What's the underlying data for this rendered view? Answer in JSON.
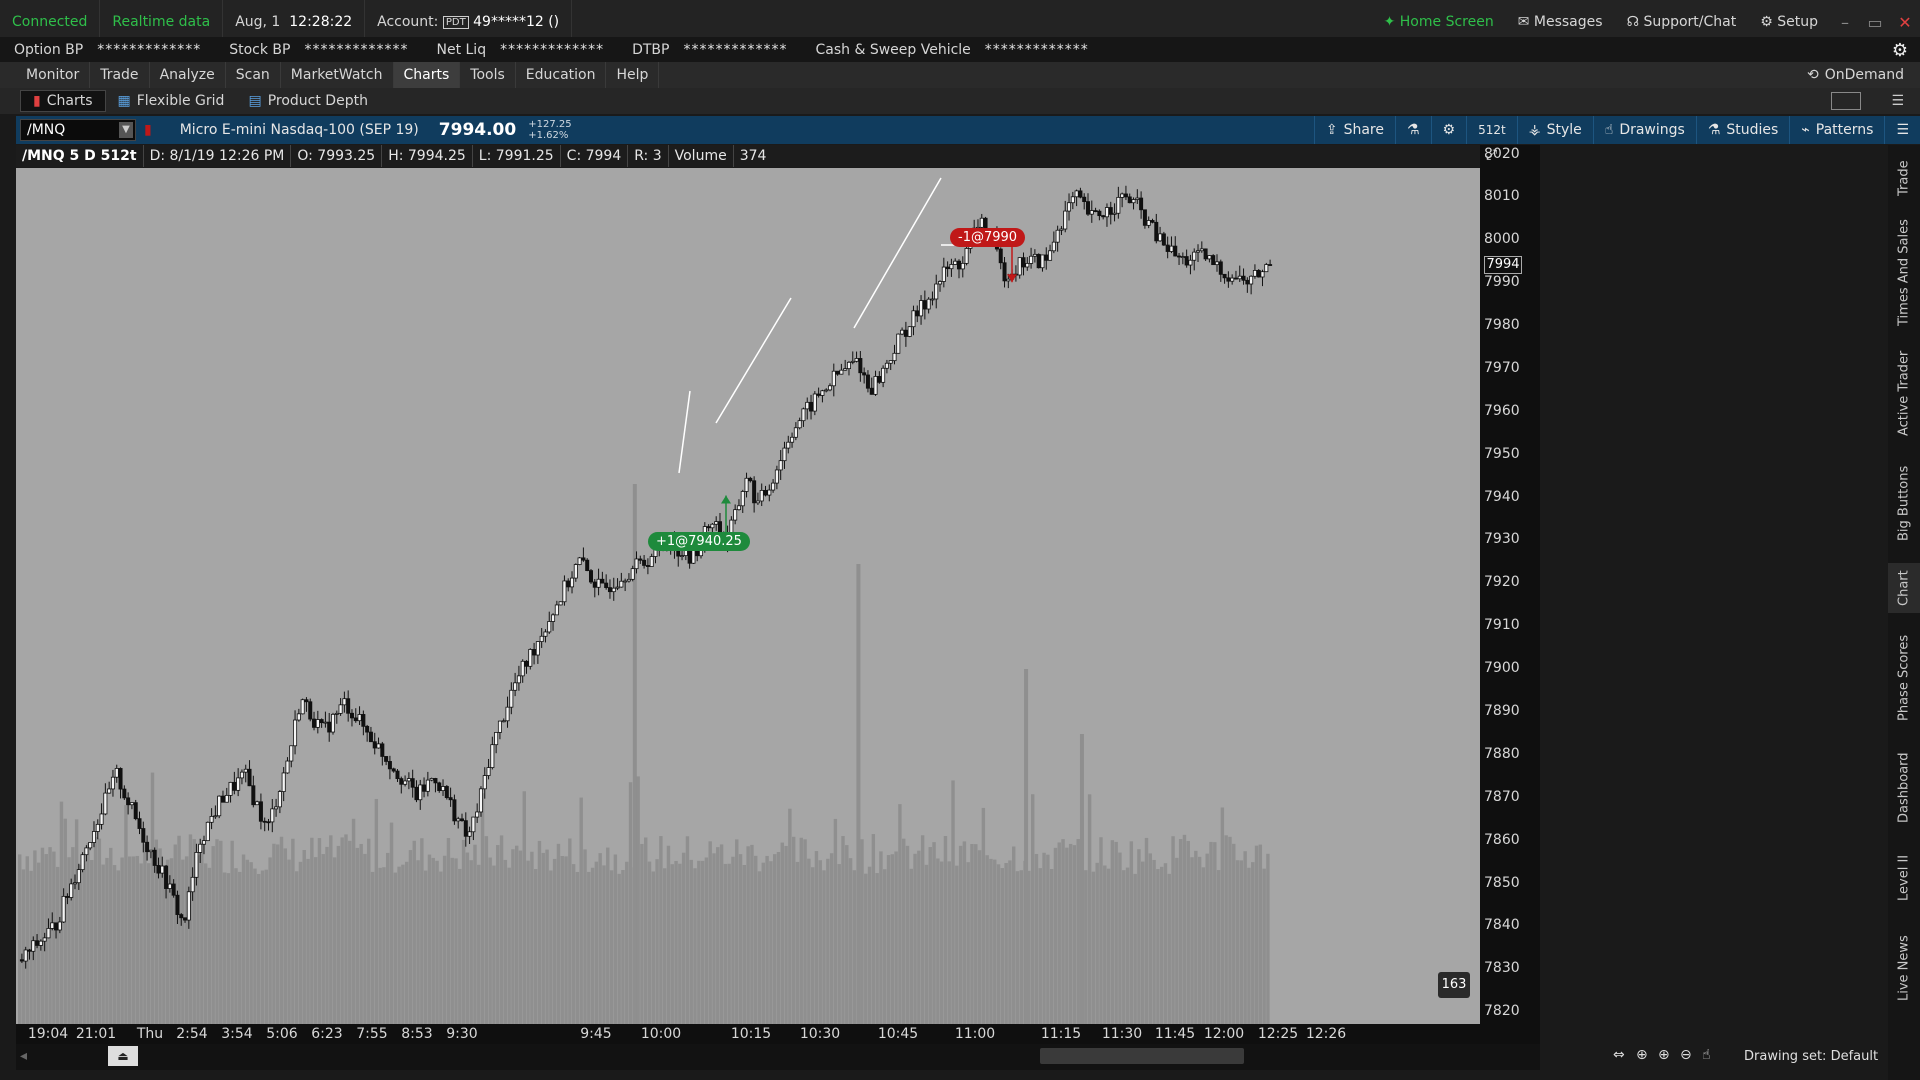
{
  "topbar": {
    "connected": "Connected",
    "realtime": "Realtime data",
    "date": "Aug, 1",
    "time": "12:28:22",
    "account_label": "Account:",
    "account_badge": "PDT",
    "account_value": "49*****12 ()",
    "home": "Home Screen",
    "messages": "Messages",
    "support": "Support/Chat",
    "setup": "Setup"
  },
  "bp": [
    {
      "label": "Option BP",
      "value": "*************"
    },
    {
      "label": "Stock BP",
      "value": "*************"
    },
    {
      "label": "Net Liq",
      "value": "*************"
    },
    {
      "label": "DTBP",
      "value": "*************"
    },
    {
      "label": "Cash & Sweep Vehicle",
      "value": "*************"
    }
  ],
  "menu": {
    "items": [
      "Monitor",
      "Trade",
      "Analyze",
      "Scan",
      "MarketWatch",
      "Charts",
      "Tools",
      "Education",
      "Help"
    ],
    "active": "Charts",
    "ondemand": "OnDemand"
  },
  "subtabs": [
    "Charts",
    "Flexible Grid",
    "Product Depth"
  ],
  "chart_header": {
    "symbol": "/MNQ",
    "description": "Micro E-mini Nasdaq-100 (SEP 19)",
    "price": "7994.00",
    "change": "+127.25",
    "change_pct": "+1.62%",
    "share": "Share",
    "aggregation": "512t",
    "style": "Style",
    "drawings": "Drawings",
    "studies": "Studies",
    "patterns": "Patterns"
  },
  "infobar": {
    "symbol": "/MNQ 5 D 512t",
    "date": "D: 8/1/19 12:26 PM",
    "open": "O: 7993.25",
    "high": "H: 7994.25",
    "low": "L: 7991.25",
    "close": "C: 7994",
    "range": "R: 3",
    "volume_label": "Volume",
    "volume_value": "374"
  },
  "chart_data": {
    "type": "candlestick",
    "y_ticks": [
      8020,
      8010,
      8000,
      7990,
      7980,
      7970,
      7960,
      7950,
      7940,
      7930,
      7920,
      7910,
      7900,
      7890,
      7880,
      7870,
      7860,
      7850,
      7840,
      7830,
      7820
    ],
    "ylim": [
      7817,
      8022
    ],
    "x_ticks": [
      "19:04",
      "21:01",
      "Thu",
      "2:54",
      "3:54",
      "5:06",
      "6:23",
      "7:55",
      "8:53",
      "9:30",
      "9:45",
      "10:00",
      "10:15",
      "10:30",
      "10:45",
      "11:00",
      "11:15",
      "11:30",
      "11:45",
      "12:00",
      "12:25",
      "12:26"
    ],
    "current_price_label": "7994",
    "price_anchors": [
      [
        0,
        7832
      ],
      [
        0.03,
        7840
      ],
      [
        0.06,
        7860
      ],
      [
        0.085,
        7875
      ],
      [
        0.11,
        7860
      ],
      [
        0.13,
        7850
      ],
      [
        0.145,
        7840
      ],
      [
        0.16,
        7860
      ],
      [
        0.18,
        7870
      ],
      [
        0.2,
        7875
      ],
      [
        0.22,
        7862
      ],
      [
        0.24,
        7880
      ],
      [
        0.25,
        7893
      ],
      [
        0.27,
        7885
      ],
      [
        0.29,
        7892
      ],
      [
        0.31,
        7885
      ],
      [
        0.33,
        7878
      ],
      [
        0.355,
        7870
      ],
      [
        0.37,
        7875
      ],
      [
        0.385,
        7868
      ],
      [
        0.4,
        7860
      ],
      [
        0.41,
        7868
      ],
      [
        0.42,
        7880
      ],
      [
        0.44,
        7895
      ],
      [
        0.46,
        7905
      ],
      [
        0.48,
        7915
      ],
      [
        0.5,
        7925
      ],
      [
        0.52,
        7918
      ],
      [
        0.54,
        7922
      ],
      [
        0.56,
        7925
      ],
      [
        0.58,
        7930
      ],
      [
        0.6,
        7925
      ],
      [
        0.61,
        7930
      ],
      [
        0.62,
        7935
      ],
      [
        0.63,
        7930
      ],
      [
        0.64,
        7935
      ],
      [
        0.65,
        7945
      ],
      [
        0.66,
        7938
      ],
      [
        0.67,
        7942
      ],
      [
        0.69,
        7955
      ],
      [
        0.71,
        7962
      ],
      [
        0.73,
        7968
      ],
      [
        0.75,
        7972
      ],
      [
        0.76,
        7965
      ],
      [
        0.77,
        7968
      ],
      [
        0.79,
        7978
      ],
      [
        0.81,
        7985
      ],
      [
        0.83,
        7993
      ],
      [
        0.845,
        7995
      ],
      [
        0.86,
        8005
      ],
      [
        0.87,
        8000
      ],
      [
        0.88,
        7992
      ],
      [
        0.89,
        7993
      ],
      [
        0.9,
        7995
      ],
      [
        0.92,
        7995
      ],
      [
        0.93,
        8003
      ],
      [
        0.945,
        8010
      ],
      [
        0.96,
        8005
      ],
      [
        0.975,
        8007
      ],
      [
        0.99,
        8010
      ],
      [
        1.0,
        8008
      ],
      [
        1.02,
        8000
      ],
      [
        1.04,
        7995
      ],
      [
        1.06,
        7996
      ],
      [
        1.08,
        7992
      ],
      [
        1.1,
        7990
      ],
      [
        1.12,
        7994
      ]
    ],
    "volume_spikes": [
      {
        "at": 0.55,
        "value": 540
      },
      {
        "at": 0.75,
        "value": 460
      },
      {
        "at": 0.9,
        "value": 355
      },
      {
        "at": 0.95,
        "value": 290
      }
    ],
    "trades": [
      {
        "label": "+1@7940.25",
        "side": "buy",
        "price": 7940.25
      },
      {
        "label": "-1@7990",
        "side": "sell",
        "price": 7990
      }
    ],
    "badge": "163"
  },
  "footer": {
    "drawing_set": "Drawing set: Default"
  },
  "rightrail": [
    "Trade",
    "Times And Sales",
    "Active Trader",
    "Big Buttons",
    "Chart",
    "Phase Scores",
    "Dashboard",
    "Level II",
    "Live News"
  ],
  "colors": {
    "plot_bg": "#a6a6a6",
    "candle": "#111111",
    "volume": "#8f8f8f",
    "buy": "#1e8a3c",
    "sell": "#c01818",
    "header_blue": "#103c5e",
    "connected": "#2fbf4a"
  }
}
